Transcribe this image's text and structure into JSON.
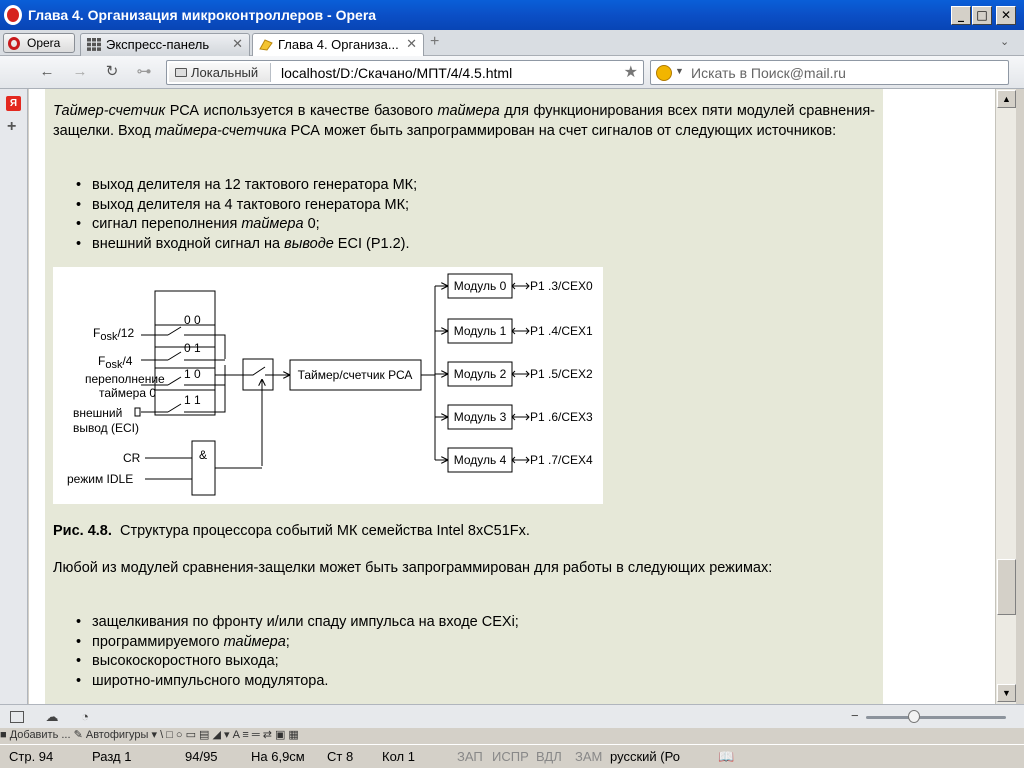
{
  "window": {
    "title": "Глава 4. Организация микроконтроллеров - Opera",
    "buttons": {
      "minimize": "_",
      "maximize": "□",
      "close": "✕"
    }
  },
  "tabs": {
    "menu_label": "Opera",
    "items": [
      {
        "label": "Экспресс-панель",
        "close": "✕"
      },
      {
        "label": "Глава 4. Организа...",
        "close": "✕"
      }
    ],
    "new_tab": "+",
    "list_arrow": "⌄"
  },
  "nav": {
    "back": "←",
    "forward": "→",
    "reload": "↻",
    "key": "⊶",
    "site_badge": "Локальный",
    "url": "localhost/D:/Скачано/МПТ/4/4.5.html",
    "bookmark_icon": "star-icon",
    "search_placeholder": "Искать в Поиск@mail.ru"
  },
  "sidepanel": {
    "yandex": "Я",
    "add": "+"
  },
  "article": {
    "intro_html": "<i>Таймер-счетчик</i> РСА используется в качестве базового <i>таймера</i> для функционирования всех пяти модулей сравнения-защелки. Вход <i>таймера-счетчика</i> РСА может быть запрограммирован на счет сигналов от следующих источников:",
    "sources_html": [
      "выход делителя на 12 тактового генератора МК;",
      "выход делителя на 4 тактового генератора МК;",
      "сигнал переполнения <i>таймера</i> 0;",
      "внешний входной сигнал на <i>выводе</i> ECI (P1.2)."
    ],
    "caption_label": "Рис. 4.8.",
    "caption_text": "Структура процессора событий МК семейства Intel 8xC51Fx.",
    "modes_intro": "Любой из модулей сравнения-защелки может быть запрограммирован для работы в следующих режимах:",
    "modes_html": [
      "защелкивания по фронту и/или спаду импульса на входе CEXi;",
      "программируемого <i>таймера</i>;",
      "высокоскоростного выхода;",
      "широтно-импульсного модулятора."
    ]
  },
  "figure": {
    "inputs": {
      "fosk12_main": "F",
      "fosk12_sub": "osk",
      "fosk12_tail": "/12",
      "fosk4_main": "F",
      "fosk4_sub": "osk",
      "fosk4_tail": "/4",
      "overflow_1": "переполнение",
      "overflow_2": "таймера 0",
      "external_1": "внешний",
      "external_2": "вывод (ECI)"
    },
    "mux_codes": [
      "0 0",
      "0 1",
      "1 0",
      "1 1"
    ],
    "cr": "CR",
    "idle": "режим IDLE",
    "and_gate": "&",
    "timer_counter": "Таймер/счетчик РСА",
    "modules": [
      "Модуль 0",
      "Модуль 1",
      "Модуль 2",
      "Модуль 3",
      "Модуль 4"
    ],
    "pins": [
      "P1 .3/CEX0",
      "P1 .4/CEX1",
      "P1 .5/CEX2",
      "P1 .6/CEX3",
      "P1 .7/CEX4"
    ]
  },
  "scrollbar": {
    "up": "▲",
    "down": "▼",
    "position_fraction": 0.79
  },
  "status": {
    "icons": [
      "panel-toggle-icon",
      "cloud-icon",
      "speed-dial-icon"
    ],
    "zoom_minus": "−",
    "zoom_level_fraction": 0.35
  },
  "word_status": {
    "toolbar_fragment": "■ Добавить ...   ✎   Автофигуры ▾   \\   □   ○   ▭   ▤   ◢   ▾   A   ≡   ═   ⇄   ▣   ▦",
    "page": "Стр. 94",
    "section": "Разд 1",
    "pages": "94/95",
    "at": "На 6,9см",
    "line": "Ст 8",
    "col": "Кол 1",
    "rec": "ЗАП",
    "trk": "ИСПР",
    "ext": "ВДЛ",
    "ovr": "ЗАМ",
    "lang": "русский (Ро"
  }
}
